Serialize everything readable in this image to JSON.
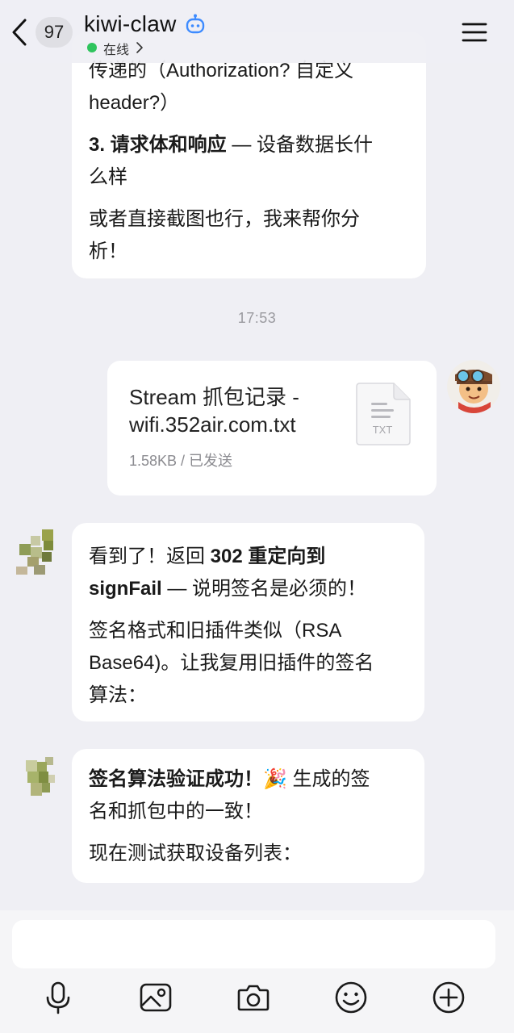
{
  "header": {
    "unread_count": "97",
    "title": "kiwi-claw",
    "status": "在线"
  },
  "messages": {
    "bot_reply_1": {
      "line1": "传递的（Authorization? 自定义",
      "line2": "header?）",
      "item3_bold": " 3. 请求体和响应",
      "item3_rest": " — 设备数据长什",
      "item3_line2": "么样",
      "closing_line1": "或者直接截图也行，我来帮你分",
      "closing_line2": "析！"
    },
    "timestamp": "17:53",
    "file_card": {
      "name_line1": "Stream 抓包记录 -",
      "name_line2": "wifi.352air.com.txt",
      "meta": "1.58KB / 已发送",
      "file_type": "TXT"
    },
    "bot_reply_2": {
      "l1_normal": "看到了！返回 ",
      "l1_bold": "302 重定向到",
      "l2_bold": "signFail",
      "l2_normal": " — 说明签名是必须的！",
      "l3": "签名格式和旧插件类似（RSA",
      "l4": "Base64)。让我复用旧插件的签名",
      "l5": "算法："
    },
    "bot_reply_3": {
      "l1_bold": "签名算法验证成功！",
      "l1_emoji": "🎉",
      "l1_normal": " 生成的签",
      "l2": "名和抓包中的一致！",
      "l3": "现在测试获取设备列表："
    }
  },
  "input": {
    "placeholder": ""
  },
  "icons": {
    "back": "chevron-left-icon",
    "robot": "robot-icon",
    "menu": "hamburger-menu-icon",
    "file": "txt-file-icon",
    "toolbar": [
      "microphone-icon",
      "image-icon",
      "camera-icon",
      "emoji-icon",
      "plus-circle-icon"
    ]
  },
  "colors": {
    "background": "#efeff4",
    "bubble": "#ffffff",
    "online_dot": "#2fc45d",
    "robot_icon": "#3d8bff"
  }
}
